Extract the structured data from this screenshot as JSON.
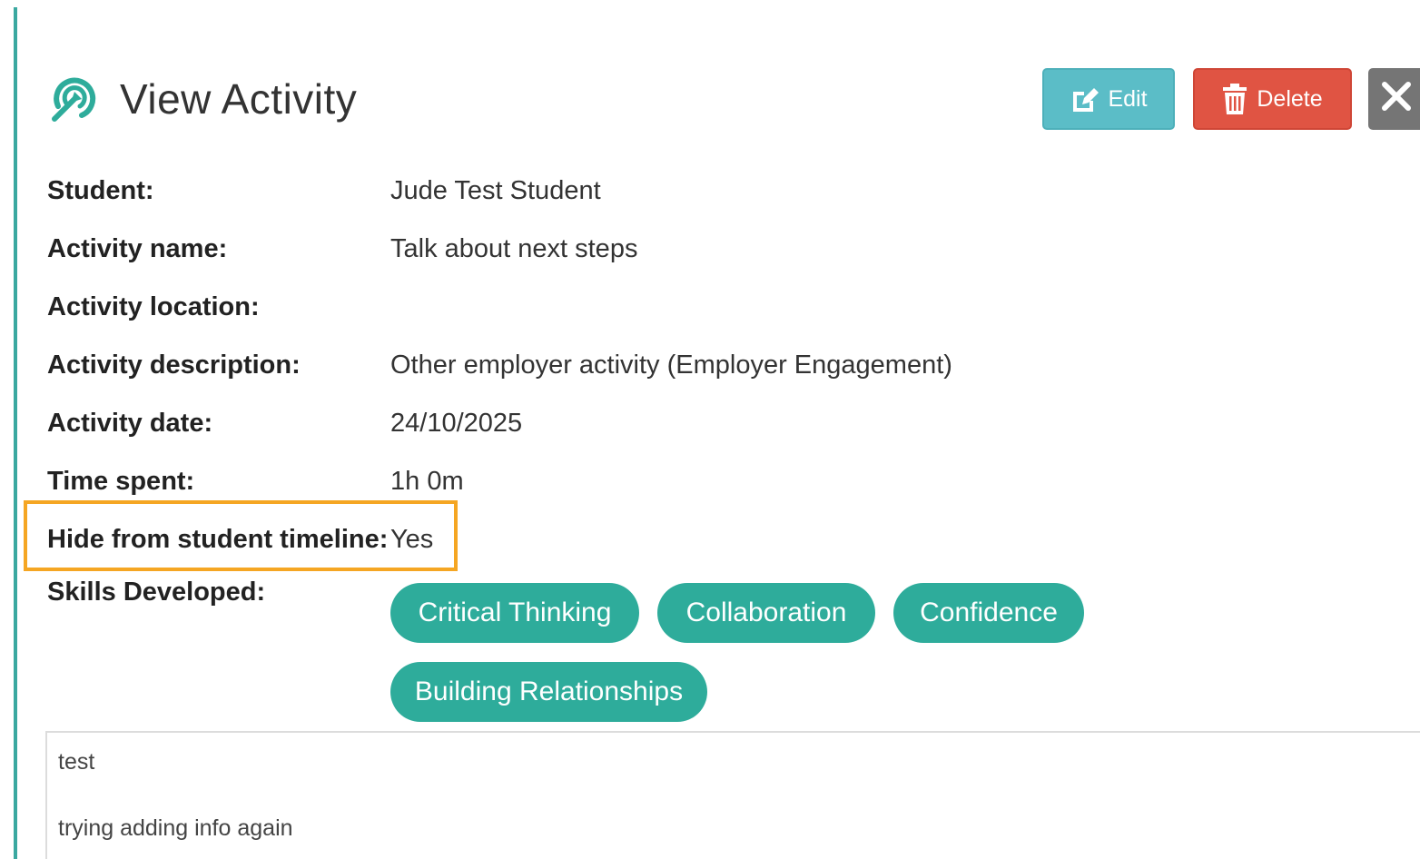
{
  "header": {
    "title": "View Activity"
  },
  "toolbar": {
    "edit_label": "Edit",
    "delete_label": "Delete",
    "close_label": "✕"
  },
  "details": [
    {
      "label": "Student:",
      "value": "Jude Test Student"
    },
    {
      "label": "Activity name:",
      "value": "Talk about next steps"
    },
    {
      "label": "Activity location:",
      "value": ""
    },
    {
      "label": "Activity description:",
      "value": "Other employer activity (Employer Engagement)"
    },
    {
      "label": "Activity date:",
      "value": "24/10/2025"
    },
    {
      "label": "Time spent:",
      "value": "1h 0m"
    },
    {
      "label": "Hide from student timeline:",
      "value": "Yes"
    }
  ],
  "skills": {
    "label": "Skills Developed:",
    "items": [
      "Critical Thinking",
      "Collaboration",
      "Confidence",
      "Building Relationships"
    ]
  },
  "notes": {
    "lines": [
      "test",
      "trying adding info again"
    ]
  },
  "colors": {
    "accent": "#3aa8a0",
    "edit": "#5bbdc7",
    "delete": "#e05443",
    "close": "#757575",
    "chip": "#2eac9b",
    "highlight": "#f5a623"
  },
  "icons": {
    "logo": "target-arrow-icon",
    "edit": "edit-icon",
    "delete": "trash-icon",
    "close": "close-icon"
  }
}
